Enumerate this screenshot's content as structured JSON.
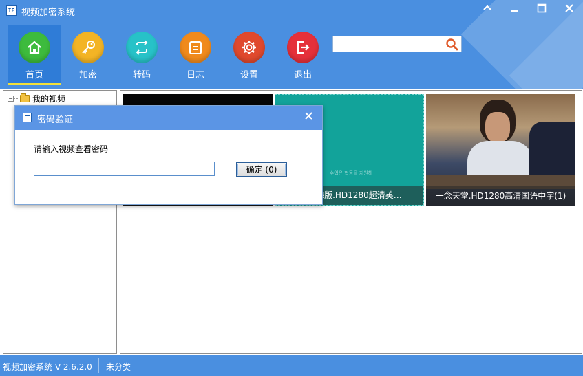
{
  "window": {
    "title": "视频加密系统"
  },
  "toolbar": {
    "items": [
      {
        "label": "首页",
        "icon": "home-icon",
        "color": "#3dbb3d"
      },
      {
        "label": "加密",
        "icon": "key-icon",
        "color": "#f3b425"
      },
      {
        "label": "转码",
        "icon": "convert-icon",
        "color": "#27c2c8"
      },
      {
        "label": "日志",
        "icon": "log-icon",
        "color": "#f08a1c"
      },
      {
        "label": "设置",
        "icon": "gear-icon",
        "color": "#e0492d"
      },
      {
        "label": "退出",
        "icon": "exit-icon",
        "color": "#e5303a"
      }
    ],
    "active": "首页"
  },
  "search": {
    "value": "",
    "placeholder": ""
  },
  "tree": {
    "root_label": "我的视频"
  },
  "videos": [
    {
      "caption": ""
    },
    {
      "caption": "…纪.韩版.HD1280超清英…",
      "subtitle_text": "수업은 협동을 지원해"
    },
    {
      "caption": "一念天堂.HD1280高清国语中字(1)"
    }
  ],
  "dialog": {
    "title": "密码验证",
    "prompt": "请输入视频查看密码",
    "password_value": "",
    "ok_label": "确定 (0)"
  },
  "status": {
    "app_version": "视频加密系统 V 2.6.2.0",
    "category": "未分类"
  },
  "colors": {
    "accent": "#4a8fe0",
    "dialog_title": "#5b95e5",
    "active_underline": "#f2e03a"
  }
}
